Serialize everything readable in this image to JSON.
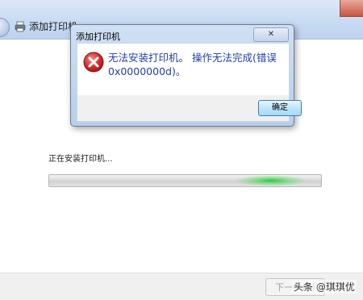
{
  "wizard": {
    "title": "添加打印机",
    "status_text": "正在安装打印机...",
    "next_button": "下一步(N)",
    "progress_indicator": "indeterminate"
  },
  "dialog": {
    "title": "添加打印机",
    "message": "无法安装打印机。 操作无法完成(错误 0x0000000d)。",
    "ok_button": "确定",
    "close_button": "✕",
    "icon": "error-icon"
  },
  "watermark": "头条 @琪琪优",
  "colors": {
    "message_text": "#1f3fa5",
    "progress_glow": "#28c83c",
    "error_red": "#d22d2d"
  }
}
